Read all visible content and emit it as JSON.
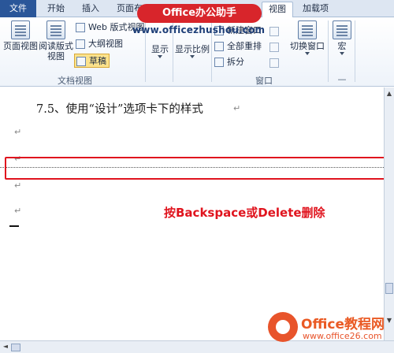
{
  "tabs": {
    "file": "文件",
    "home": "开始",
    "insert": "插入",
    "page_layout": "页面布",
    "view": "视图",
    "addins": "加载项"
  },
  "watermark": {
    "banner": "Office办公助手",
    "url": "www.officezhushou.com"
  },
  "ribbon": {
    "doc_views": {
      "page_view": "页面视图",
      "reading_view_line1": "阅读版式",
      "reading_view_line2": "视图",
      "web_view": "Web 版式视图",
      "outline_view": "大纲视图",
      "draft_view": "草稿",
      "group_label": "文档视图"
    },
    "show": "显示",
    "zoom": "显示比例",
    "window": {
      "new_window": "新建窗口",
      "arrange_all": "全部重排",
      "split": "拆分",
      "switch_window": "切换窗口",
      "group_label": "窗口"
    },
    "macros": "宏"
  },
  "document": {
    "heading": "7.5、使用“设计”选项卡下的样式",
    "paragraph_mark": "↵",
    "annotation": "按Backspace或Delete删除"
  },
  "scrollbar": {
    "up_arrow": "▲",
    "down_arrow": "▼",
    "left_arrow": "◄"
  },
  "logo": {
    "text": "Office教程网",
    "url": "www.office26.com"
  },
  "colors": {
    "file_tab": "#2a5699",
    "highlight_red": "#e0141e",
    "logo_orange": "#e8542b"
  }
}
